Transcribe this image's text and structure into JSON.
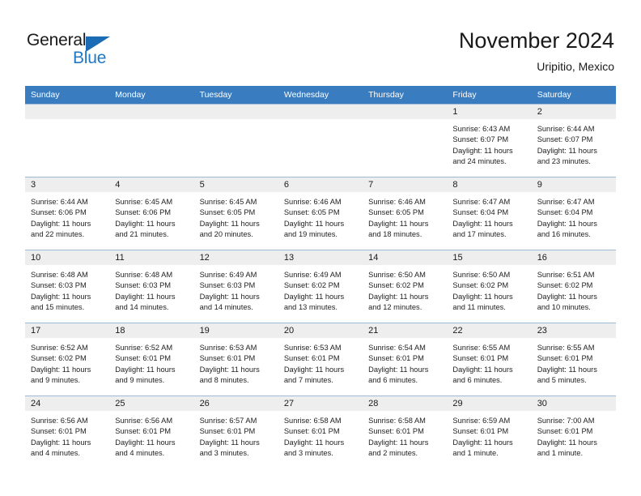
{
  "logo": {
    "word1": "General",
    "word2": "Blue",
    "triangle_color": "#1b6cb5",
    "blue_color": "#2079c4"
  },
  "header": {
    "title": "November 2024",
    "subtitle": "Uripitio, Mexico"
  },
  "theme": {
    "header_row_bg": "#3a7cc0",
    "daynum_bg": "#eeeeee",
    "cell_border": "#9fb8d4",
    "text": "#1a1a1a"
  },
  "weekdays": [
    "Sunday",
    "Monday",
    "Tuesday",
    "Wednesday",
    "Thursday",
    "Friday",
    "Saturday"
  ],
  "weeks": [
    [
      {
        "day": "",
        "empty": true
      },
      {
        "day": "",
        "empty": true
      },
      {
        "day": "",
        "empty": true
      },
      {
        "day": "",
        "empty": true
      },
      {
        "day": "",
        "empty": true
      },
      {
        "day": "1",
        "sunrise": "Sunrise: 6:43 AM",
        "sunset": "Sunset: 6:07 PM",
        "daylight1": "Daylight: 11 hours",
        "daylight2": "and 24 minutes."
      },
      {
        "day": "2",
        "sunrise": "Sunrise: 6:44 AM",
        "sunset": "Sunset: 6:07 PM",
        "daylight1": "Daylight: 11 hours",
        "daylight2": "and 23 minutes."
      }
    ],
    [
      {
        "day": "3",
        "sunrise": "Sunrise: 6:44 AM",
        "sunset": "Sunset: 6:06 PM",
        "daylight1": "Daylight: 11 hours",
        "daylight2": "and 22 minutes."
      },
      {
        "day": "4",
        "sunrise": "Sunrise: 6:45 AM",
        "sunset": "Sunset: 6:06 PM",
        "daylight1": "Daylight: 11 hours",
        "daylight2": "and 21 minutes."
      },
      {
        "day": "5",
        "sunrise": "Sunrise: 6:45 AM",
        "sunset": "Sunset: 6:05 PM",
        "daylight1": "Daylight: 11 hours",
        "daylight2": "and 20 minutes."
      },
      {
        "day": "6",
        "sunrise": "Sunrise: 6:46 AM",
        "sunset": "Sunset: 6:05 PM",
        "daylight1": "Daylight: 11 hours",
        "daylight2": "and 19 minutes."
      },
      {
        "day": "7",
        "sunrise": "Sunrise: 6:46 AM",
        "sunset": "Sunset: 6:05 PM",
        "daylight1": "Daylight: 11 hours",
        "daylight2": "and 18 minutes."
      },
      {
        "day": "8",
        "sunrise": "Sunrise: 6:47 AM",
        "sunset": "Sunset: 6:04 PM",
        "daylight1": "Daylight: 11 hours",
        "daylight2": "and 17 minutes."
      },
      {
        "day": "9",
        "sunrise": "Sunrise: 6:47 AM",
        "sunset": "Sunset: 6:04 PM",
        "daylight1": "Daylight: 11 hours",
        "daylight2": "and 16 minutes."
      }
    ],
    [
      {
        "day": "10",
        "sunrise": "Sunrise: 6:48 AM",
        "sunset": "Sunset: 6:03 PM",
        "daylight1": "Daylight: 11 hours",
        "daylight2": "and 15 minutes."
      },
      {
        "day": "11",
        "sunrise": "Sunrise: 6:48 AM",
        "sunset": "Sunset: 6:03 PM",
        "daylight1": "Daylight: 11 hours",
        "daylight2": "and 14 minutes."
      },
      {
        "day": "12",
        "sunrise": "Sunrise: 6:49 AM",
        "sunset": "Sunset: 6:03 PM",
        "daylight1": "Daylight: 11 hours",
        "daylight2": "and 14 minutes."
      },
      {
        "day": "13",
        "sunrise": "Sunrise: 6:49 AM",
        "sunset": "Sunset: 6:02 PM",
        "daylight1": "Daylight: 11 hours",
        "daylight2": "and 13 minutes."
      },
      {
        "day": "14",
        "sunrise": "Sunrise: 6:50 AM",
        "sunset": "Sunset: 6:02 PM",
        "daylight1": "Daylight: 11 hours",
        "daylight2": "and 12 minutes."
      },
      {
        "day": "15",
        "sunrise": "Sunrise: 6:50 AM",
        "sunset": "Sunset: 6:02 PM",
        "daylight1": "Daylight: 11 hours",
        "daylight2": "and 11 minutes."
      },
      {
        "day": "16",
        "sunrise": "Sunrise: 6:51 AM",
        "sunset": "Sunset: 6:02 PM",
        "daylight1": "Daylight: 11 hours",
        "daylight2": "and 10 minutes."
      }
    ],
    [
      {
        "day": "17",
        "sunrise": "Sunrise: 6:52 AM",
        "sunset": "Sunset: 6:02 PM",
        "daylight1": "Daylight: 11 hours",
        "daylight2": "and 9 minutes."
      },
      {
        "day": "18",
        "sunrise": "Sunrise: 6:52 AM",
        "sunset": "Sunset: 6:01 PM",
        "daylight1": "Daylight: 11 hours",
        "daylight2": "and 9 minutes."
      },
      {
        "day": "19",
        "sunrise": "Sunrise: 6:53 AM",
        "sunset": "Sunset: 6:01 PM",
        "daylight1": "Daylight: 11 hours",
        "daylight2": "and 8 minutes."
      },
      {
        "day": "20",
        "sunrise": "Sunrise: 6:53 AM",
        "sunset": "Sunset: 6:01 PM",
        "daylight1": "Daylight: 11 hours",
        "daylight2": "and 7 minutes."
      },
      {
        "day": "21",
        "sunrise": "Sunrise: 6:54 AM",
        "sunset": "Sunset: 6:01 PM",
        "daylight1": "Daylight: 11 hours",
        "daylight2": "and 6 minutes."
      },
      {
        "day": "22",
        "sunrise": "Sunrise: 6:55 AM",
        "sunset": "Sunset: 6:01 PM",
        "daylight1": "Daylight: 11 hours",
        "daylight2": "and 6 minutes."
      },
      {
        "day": "23",
        "sunrise": "Sunrise: 6:55 AM",
        "sunset": "Sunset: 6:01 PM",
        "daylight1": "Daylight: 11 hours",
        "daylight2": "and 5 minutes."
      }
    ],
    [
      {
        "day": "24",
        "sunrise": "Sunrise: 6:56 AM",
        "sunset": "Sunset: 6:01 PM",
        "daylight1": "Daylight: 11 hours",
        "daylight2": "and 4 minutes."
      },
      {
        "day": "25",
        "sunrise": "Sunrise: 6:56 AM",
        "sunset": "Sunset: 6:01 PM",
        "daylight1": "Daylight: 11 hours",
        "daylight2": "and 4 minutes."
      },
      {
        "day": "26",
        "sunrise": "Sunrise: 6:57 AM",
        "sunset": "Sunset: 6:01 PM",
        "daylight1": "Daylight: 11 hours",
        "daylight2": "and 3 minutes."
      },
      {
        "day": "27",
        "sunrise": "Sunrise: 6:58 AM",
        "sunset": "Sunset: 6:01 PM",
        "daylight1": "Daylight: 11 hours",
        "daylight2": "and 3 minutes."
      },
      {
        "day": "28",
        "sunrise": "Sunrise: 6:58 AM",
        "sunset": "Sunset: 6:01 PM",
        "daylight1": "Daylight: 11 hours",
        "daylight2": "and 2 minutes."
      },
      {
        "day": "29",
        "sunrise": "Sunrise: 6:59 AM",
        "sunset": "Sunset: 6:01 PM",
        "daylight1": "Daylight: 11 hours",
        "daylight2": "and 1 minute."
      },
      {
        "day": "30",
        "sunrise": "Sunrise: 7:00 AM",
        "sunset": "Sunset: 6:01 PM",
        "daylight1": "Daylight: 11 hours",
        "daylight2": "and 1 minute."
      }
    ]
  ]
}
